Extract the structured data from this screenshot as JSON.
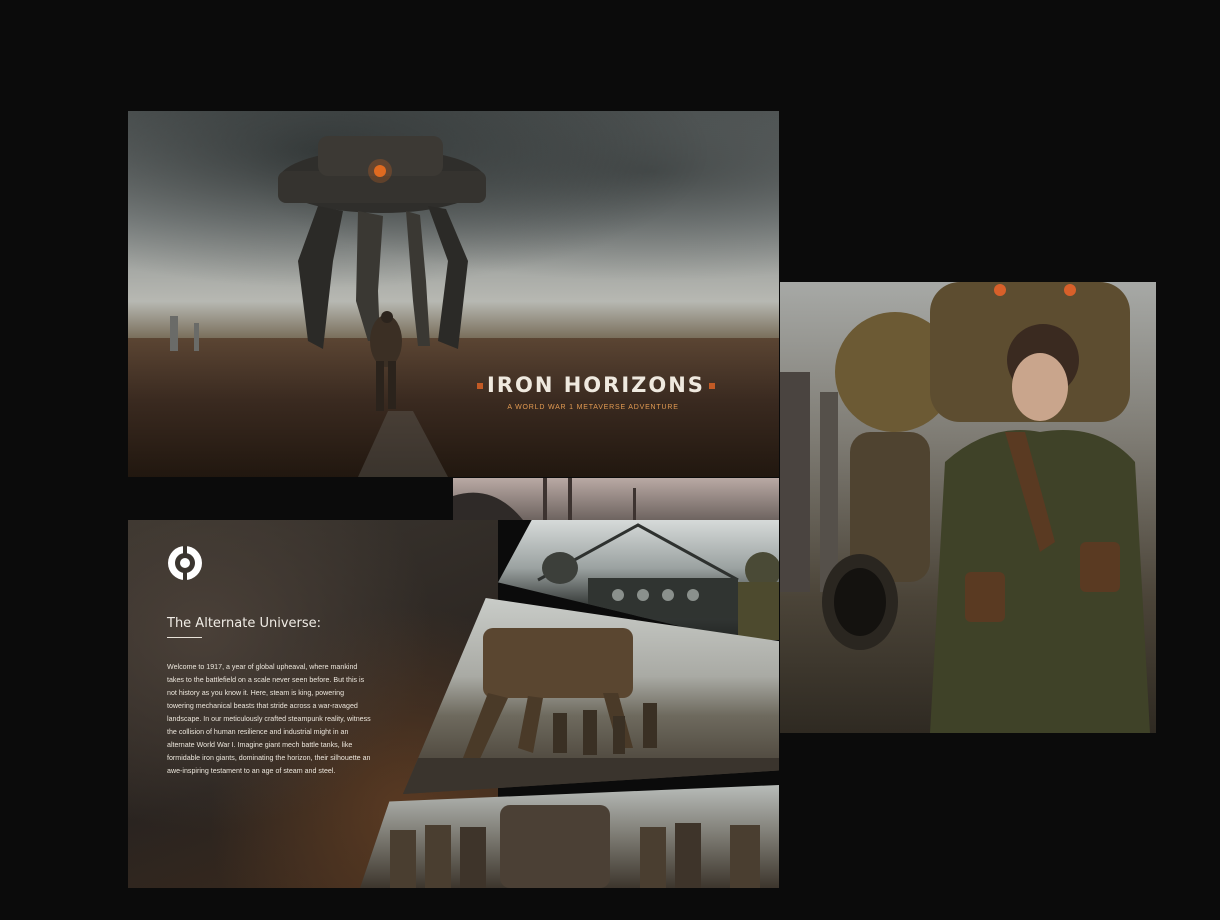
{
  "hero": {
    "title": "IRON HORIZONS",
    "subtitle": "A WORLD WAR 1 METAVERSE ADVENTURE"
  },
  "section": {
    "title": "The Alternate Universe:",
    "body": "Welcome to 1917, a year of global upheaval, where mankind takes to the battlefield on a scale never seen before. But this is not history as you know it. Here, steam is king, powering towering mechanical beasts that stride across a war-ravaged landscape. In our meticulously crafted steampunk reality, witness the collision of human resilience and industrial might in an alternate World War I. Imagine giant mech battle tanks, like formidable iron giants, dominating the horizon, their silhouette an awe-inspiring testament to an age of steam and steel."
  },
  "colors": {
    "background": "#0b0b0b",
    "accent": "#c25a25",
    "subtitle": "#e19a52"
  }
}
